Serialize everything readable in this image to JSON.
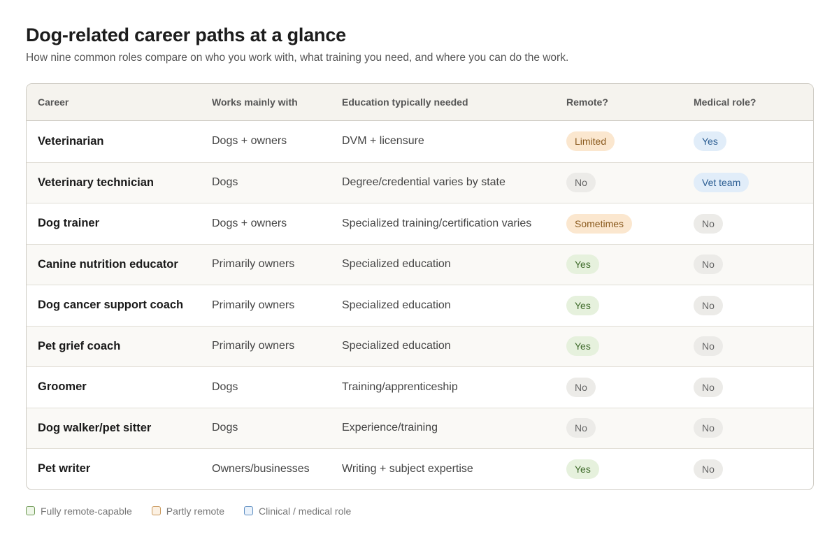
{
  "title": "Dog-related career paths at a glance",
  "subtitle": "How nine common roles compare on who you work with, what training you need, and where you can do the work.",
  "table": {
    "headers": [
      "Career",
      "Works mainly with",
      "Education typically needed",
      "Remote?",
      "Medical role?"
    ],
    "rows": [
      {
        "career": "Veterinarian",
        "works_with": "Dogs + owners",
        "education": "DVM + licensure",
        "remote": "Limited",
        "medical": "Yes"
      },
      {
        "career": "Veterinary technician",
        "works_with": "Dogs",
        "education": "Degree/credential varies by state",
        "remote": "No",
        "medical": "Vet team"
      },
      {
        "career": "Dog trainer",
        "works_with": "Dogs + owners",
        "education": "Specialized training/certification varies",
        "remote": "Sometimes",
        "medical": "No"
      },
      {
        "career": "Canine nutrition educator",
        "works_with": "Primarily owners",
        "education": "Specialized education",
        "remote": "Yes",
        "medical": "No"
      },
      {
        "career": "Dog cancer support coach",
        "works_with": "Primarily owners",
        "education": "Specialized education",
        "remote": "Yes",
        "medical": "No"
      },
      {
        "career": "Pet grief coach",
        "works_with": "Primarily owners",
        "education": "Specialized education",
        "remote": "Yes",
        "medical": "No"
      },
      {
        "career": "Groomer",
        "works_with": "Dogs",
        "education": "Training/apprenticeship",
        "remote": "No",
        "medical": "No"
      },
      {
        "career": "Dog walker/pet sitter",
        "works_with": "Dogs",
        "education": "Experience/training",
        "remote": "No",
        "medical": "No"
      },
      {
        "career": "Pet writer",
        "works_with": "Owners/businesses",
        "education": "Writing + subject expertise",
        "remote": "Yes",
        "medical": "No"
      }
    ]
  },
  "legend": [
    {
      "label": "Fully remote-capable",
      "color": "#6f9a55"
    },
    {
      "label": "Partly remote",
      "color": "#c9975a"
    },
    {
      "label": "Clinical / medical role",
      "color": "#5f8fc2"
    }
  ],
  "colors": {
    "remote_yes": "#e6f1dd",
    "remote_partial": "#fbe7cf",
    "medical": "#e1edf9",
    "neutral": "#ecebe8"
  }
}
